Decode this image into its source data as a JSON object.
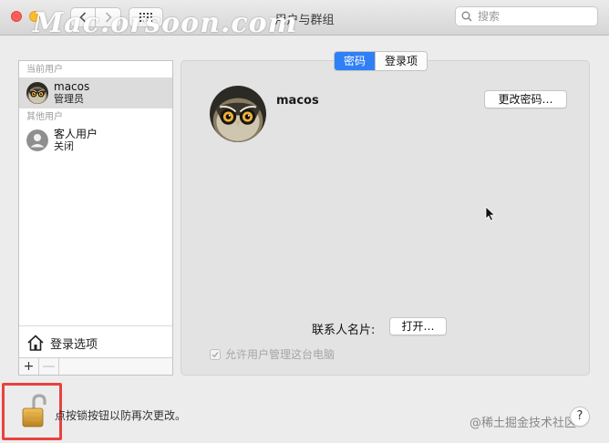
{
  "window": {
    "title": "用户与群组",
    "watermark": "Mac.orsoon.com"
  },
  "toolbar": {
    "back_icon": "chevron-left-icon",
    "forward_icon": "chevron-right-icon",
    "grid_icon": "show-all-grid-icon"
  },
  "search": {
    "placeholder": "搜索",
    "value": ""
  },
  "sidebar": {
    "current_header": "当前用户",
    "current_user": {
      "name": "macos",
      "role": "管理员"
    },
    "other_header": "其他用户",
    "other_users": [
      {
        "name": "客人用户",
        "status": "关闭"
      }
    ],
    "login_options_label": "登录选项",
    "add_label": "+",
    "remove_label": "—"
  },
  "tabs": [
    {
      "label": "密码",
      "active": true
    },
    {
      "label": "登录项",
      "active": false
    }
  ],
  "detail": {
    "username": "macos",
    "change_password_label": "更改密码…",
    "contact_card_label": "联系人名片:",
    "open_label": "打开…",
    "allow_admin_label": "允许用户管理这台电脑",
    "allow_admin_checked": true
  },
  "footer": {
    "lock_hint": "点按锁按钮以防再次更改。",
    "help_label": "?",
    "site_watermark": "@稀土掘金技术社区"
  },
  "colors": {
    "accent": "#2f7ff6",
    "highlight_frame": "#e8423f",
    "close": "#fc5f57",
    "minimize": "#fdbc2e"
  }
}
